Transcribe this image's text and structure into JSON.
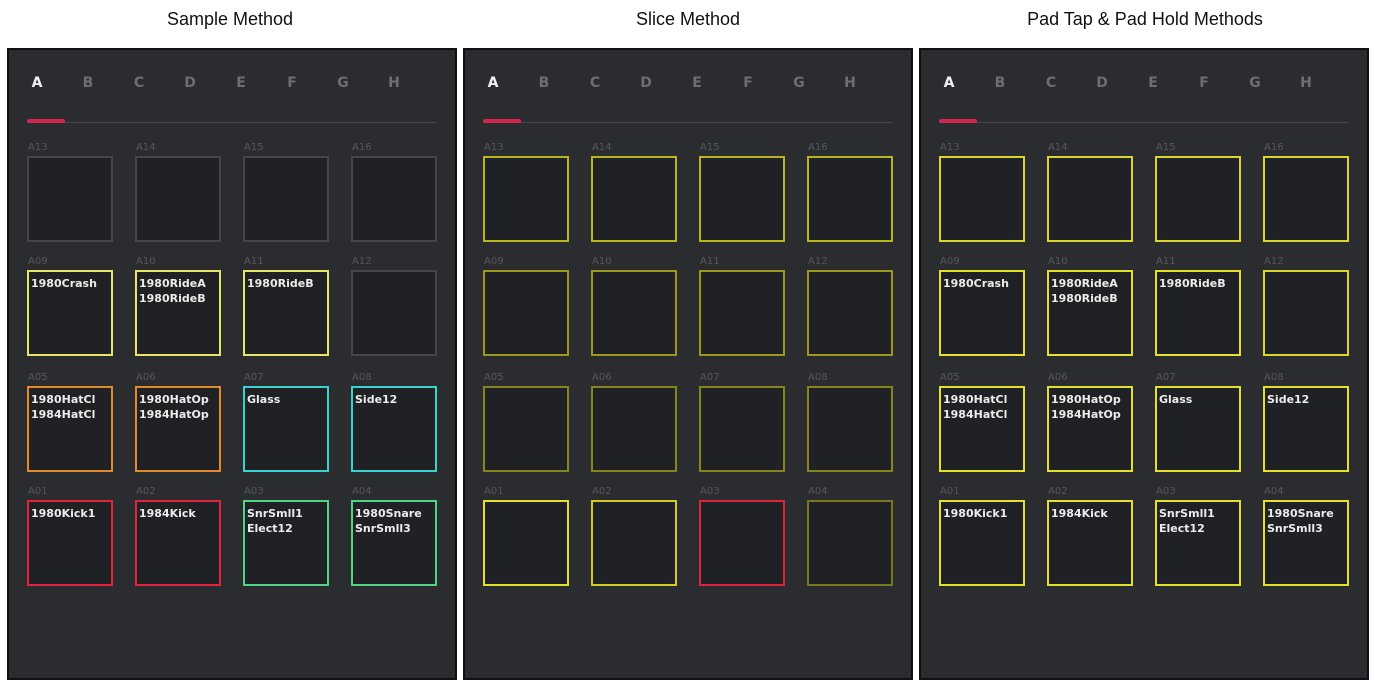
{
  "panels": [
    {
      "caption": "Sample Method",
      "banks": [
        "A",
        "B",
        "C",
        "D",
        "E",
        "F",
        "G",
        "H"
      ],
      "active_bank": "A",
      "rows": [
        [
          {
            "label": "A13",
            "names": [],
            "color": "#44464b"
          },
          {
            "label": "A14",
            "names": [],
            "color": "#44464b"
          },
          {
            "label": "A15",
            "names": [],
            "color": "#44464b"
          },
          {
            "label": "A16",
            "names": [],
            "color": "#44464b"
          }
        ],
        [
          {
            "label": "A09",
            "names": [
              "1980Crash"
            ],
            "color": "#e7e46a"
          },
          {
            "label": "A10",
            "names": [
              "1980RideA",
              "1980RideB"
            ],
            "color": "#e7e46a"
          },
          {
            "label": "A11",
            "names": [
              "1980RideB"
            ],
            "color": "#e7e46a"
          },
          {
            "label": "A12",
            "names": [],
            "color": "#44464b"
          }
        ],
        [
          {
            "label": "A05",
            "names": [
              "1980HatCl",
              "1984HatCl"
            ],
            "color": "#e08a2a"
          },
          {
            "label": "A06",
            "names": [
              "1980HatOp",
              "1984HatOp"
            ],
            "color": "#e08a2a"
          },
          {
            "label": "A07",
            "names": [
              "Glass"
            ],
            "color": "#38d3cf"
          },
          {
            "label": "A08",
            "names": [
              "Side12"
            ],
            "color": "#38d3cf"
          }
        ],
        [
          {
            "label": "A01",
            "names": [
              "1980Kick1"
            ],
            "color": "#e2233a"
          },
          {
            "label": "A02",
            "names": [
              "1984Kick"
            ],
            "color": "#e2233a"
          },
          {
            "label": "A03",
            "names": [
              "SnrSmll1",
              "Elect12"
            ],
            "color": "#4fd486"
          },
          {
            "label": "A04",
            "names": [
              "1980Snare",
              "SnrSmll3"
            ],
            "color": "#4fd486"
          }
        ]
      ]
    },
    {
      "caption": "Slice Method",
      "banks": [
        "A",
        "B",
        "C",
        "D",
        "E",
        "F",
        "G",
        "H"
      ],
      "active_bank": "A",
      "rows": [
        [
          {
            "label": "A13",
            "names": [],
            "color": "#b9b51f"
          },
          {
            "label": "A14",
            "names": [],
            "color": "#b9b51f"
          },
          {
            "label": "A15",
            "names": [],
            "color": "#b9b51f"
          },
          {
            "label": "A16",
            "names": [],
            "color": "#b9b51f"
          }
        ],
        [
          {
            "label": "A09",
            "names": [],
            "color": "#9b981d"
          },
          {
            "label": "A10",
            "names": [],
            "color": "#9b981d"
          },
          {
            "label": "A11",
            "names": [],
            "color": "#9b981d"
          },
          {
            "label": "A12",
            "names": [],
            "color": "#9b981d"
          }
        ],
        [
          {
            "label": "A05",
            "names": [],
            "color": "#87841c"
          },
          {
            "label": "A06",
            "names": [],
            "color": "#87841c"
          },
          {
            "label": "A07",
            "names": [],
            "color": "#87841c"
          },
          {
            "label": "A08",
            "names": [],
            "color": "#87841c"
          }
        ],
        [
          {
            "label": "A01",
            "names": [],
            "color": "#e5e12a"
          },
          {
            "label": "A02",
            "names": [],
            "color": "#cfcb24"
          },
          {
            "label": "A03",
            "names": [],
            "color": "#d9243a"
          },
          {
            "label": "A04",
            "names": [],
            "color": "#7a781c"
          }
        ]
      ]
    },
    {
      "caption": "Pad Tap & Pad Hold Methods",
      "banks": [
        "A",
        "B",
        "C",
        "D",
        "E",
        "F",
        "G",
        "H"
      ],
      "active_bank": "A",
      "rows": [
        [
          {
            "label": "A13",
            "names": [],
            "color": "#d9d52a"
          },
          {
            "label": "A14",
            "names": [],
            "color": "#d9d52a"
          },
          {
            "label": "A15",
            "names": [],
            "color": "#d9d52a"
          },
          {
            "label": "A16",
            "names": [],
            "color": "#d9d52a"
          }
        ],
        [
          {
            "label": "A09",
            "names": [
              "1980Crash"
            ],
            "color": "#e5e12a"
          },
          {
            "label": "A10",
            "names": [
              "1980RideA",
              "1980RideB"
            ],
            "color": "#e5e12a"
          },
          {
            "label": "A11",
            "names": [
              "1980RideB"
            ],
            "color": "#e5e12a"
          },
          {
            "label": "A12",
            "names": [],
            "color": "#d9d52a"
          }
        ],
        [
          {
            "label": "A05",
            "names": [
              "1980HatCl",
              "1984HatCl"
            ],
            "color": "#e5e12a"
          },
          {
            "label": "A06",
            "names": [
              "1980HatOp",
              "1984HatOp"
            ],
            "color": "#e5e12a"
          },
          {
            "label": "A07",
            "names": [
              "Glass"
            ],
            "color": "#e5e12a"
          },
          {
            "label": "A08",
            "names": [
              "Side12"
            ],
            "color": "#e5e12a"
          }
        ],
        [
          {
            "label": "A01",
            "names": [
              "1980Kick1"
            ],
            "color": "#e5e12a"
          },
          {
            "label": "A02",
            "names": [
              "1984Kick"
            ],
            "color": "#e5e12a"
          },
          {
            "label": "A03",
            "names": [
              "SnrSmll1",
              "Elect12"
            ],
            "color": "#e5e12a"
          },
          {
            "label": "A04",
            "names": [
              "1980Snare",
              "SnrSmll3"
            ],
            "color": "#e5e12a"
          }
        ]
      ]
    }
  ]
}
